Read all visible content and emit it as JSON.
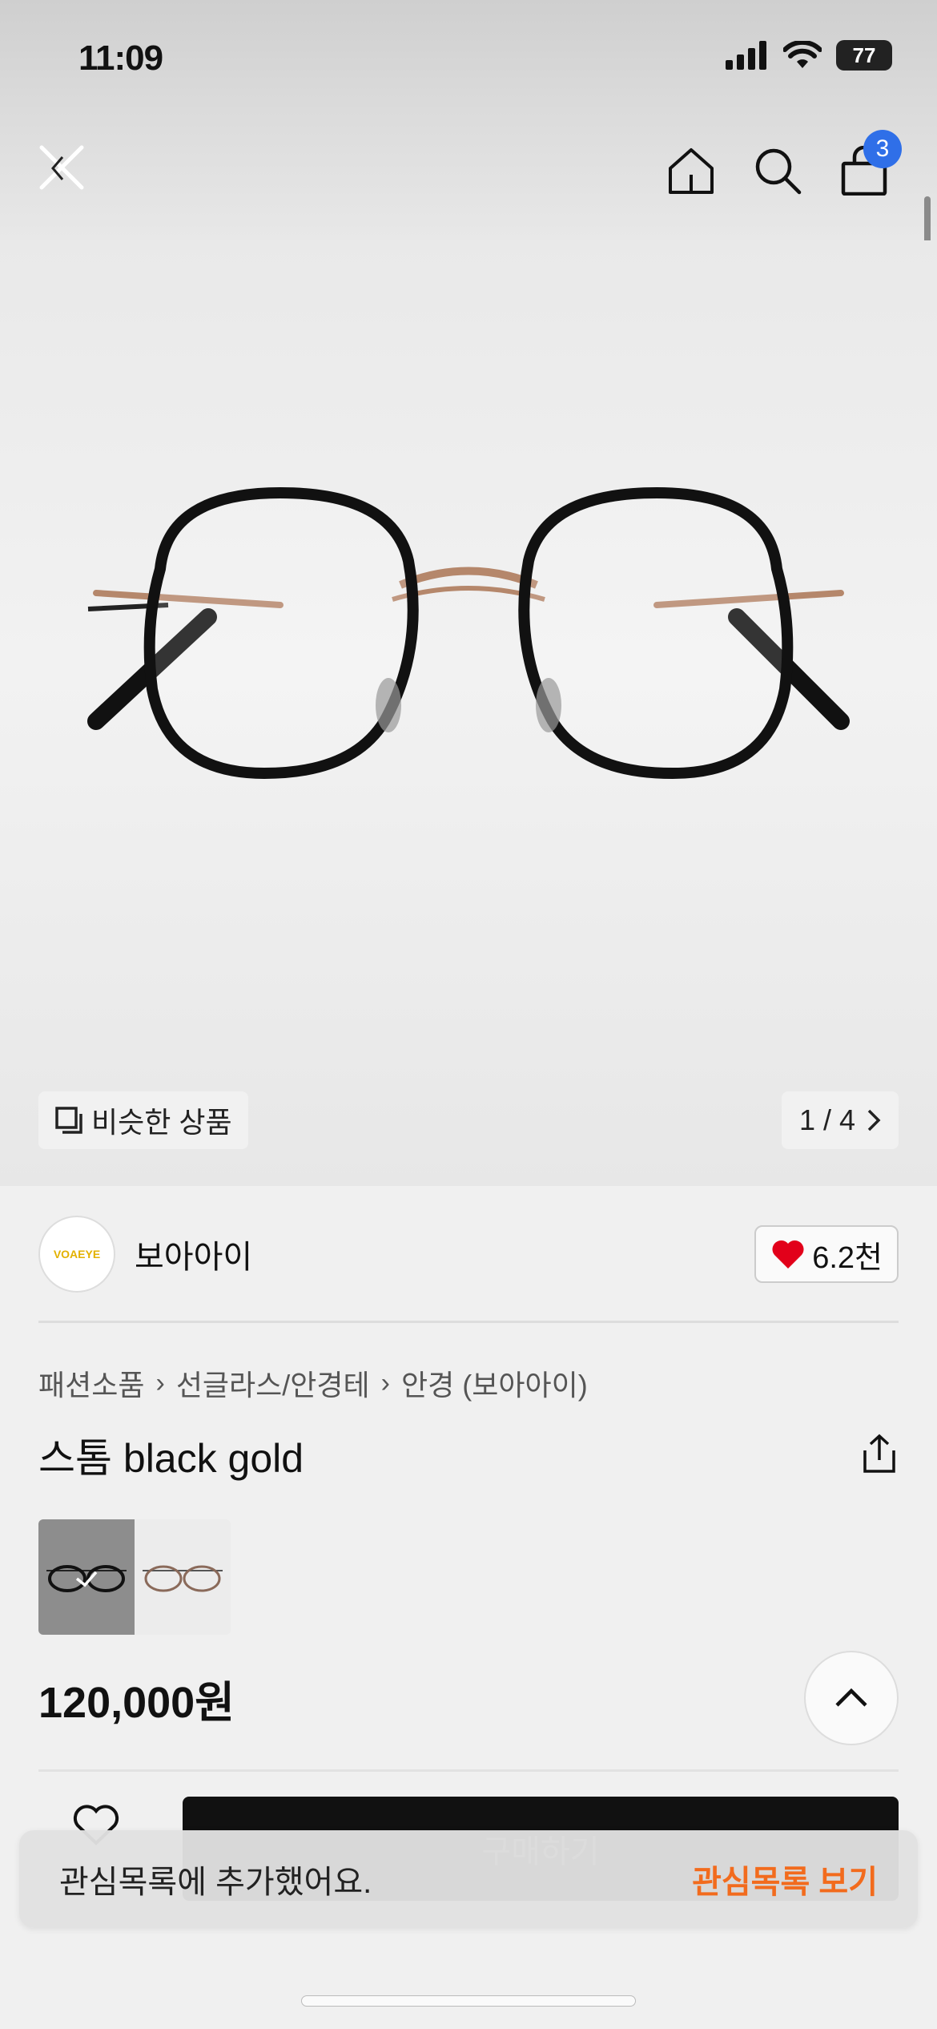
{
  "status_bar": {
    "time": "11:09",
    "battery": "77"
  },
  "header": {
    "cart_count": "3"
  },
  "gallery": {
    "similar_label": "비슷한 상품",
    "pager": "1 / 4"
  },
  "brand": {
    "logo_text": "VOAEYE",
    "name": "보아아이",
    "likes": "6.2천"
  },
  "breadcrumb": [
    "패션소품",
    "선글라스/안경테",
    "안경 (보아아이)"
  ],
  "product": {
    "title": "스톰 black gold",
    "price": "120,000원"
  },
  "bottom_bar": {
    "buy_label": "구매하기"
  },
  "toast": {
    "message": "관심목록에 추가했어요.",
    "action": "관심목록 보기"
  },
  "colors": {
    "accent_orange": "#f26b1d",
    "badge_blue": "#2f6fe8",
    "heart_red": "#e2001a"
  }
}
